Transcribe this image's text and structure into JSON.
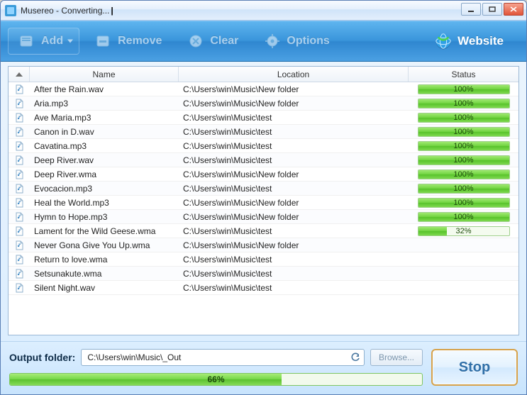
{
  "window": {
    "title": "Musereo - Converting..."
  },
  "toolbar": {
    "add": "Add",
    "remove": "Remove",
    "clear": "Clear",
    "options": "Options",
    "website": "Website"
  },
  "columns": {
    "name": "Name",
    "location": "Location",
    "status": "Status"
  },
  "files": [
    {
      "name": "After the Rain.wav",
      "location": "C:\\Users\\win\\Music\\New folder",
      "progress": 100
    },
    {
      "name": "Aria.mp3",
      "location": "C:\\Users\\win\\Music\\New folder",
      "progress": 100
    },
    {
      "name": "Ave Maria.mp3",
      "location": "C:\\Users\\win\\Music\\test",
      "progress": 100
    },
    {
      "name": "Canon in D.wav",
      "location": "C:\\Users\\win\\Music\\test",
      "progress": 100
    },
    {
      "name": "Cavatina.mp3",
      "location": "C:\\Users\\win\\Music\\test",
      "progress": 100
    },
    {
      "name": "Deep River.wav",
      "location": "C:\\Users\\win\\Music\\test",
      "progress": 100
    },
    {
      "name": "Deep River.wma",
      "location": "C:\\Users\\win\\Music\\New folder",
      "progress": 100
    },
    {
      "name": "Evocacion.mp3",
      "location": "C:\\Users\\win\\Music\\test",
      "progress": 100
    },
    {
      "name": "Heal the World.mp3",
      "location": "C:\\Users\\win\\Music\\New folder",
      "progress": 100
    },
    {
      "name": "Hymn to Hope.mp3",
      "location": "C:\\Users\\win\\Music\\New folder",
      "progress": 100
    },
    {
      "name": "Lament for the Wild Geese.wma",
      "location": "C:\\Users\\win\\Music\\test",
      "progress": 32
    },
    {
      "name": "Never Gona Give You Up.wma",
      "location": "C:\\Users\\win\\Music\\New folder",
      "progress": null
    },
    {
      "name": "Return to love.wma",
      "location": "C:\\Users\\win\\Music\\test",
      "progress": null
    },
    {
      "name": "Setsunakute.wma",
      "location": "C:\\Users\\win\\Music\\test",
      "progress": null
    },
    {
      "name": "Silent Night.wav",
      "location": "C:\\Users\\win\\Music\\test",
      "progress": null
    }
  ],
  "output": {
    "label": "Output folder:",
    "path": "C:\\Users\\win\\Music\\_Out",
    "browse": "Browse..."
  },
  "overall": {
    "progress": 66
  },
  "actions": {
    "stop": "Stop"
  }
}
